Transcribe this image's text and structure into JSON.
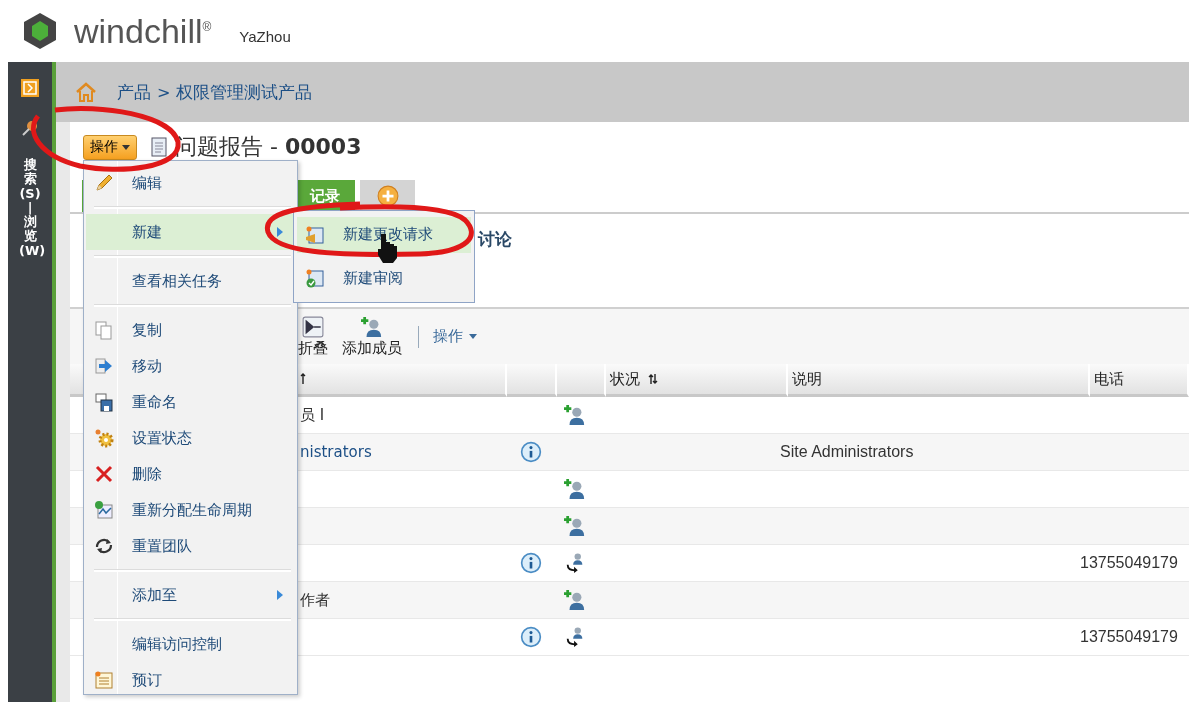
{
  "header": {
    "logo": "windchill$^{®}$",
    "user": "YaZhou"
  },
  "nav": {
    "vertical_label": "搜索(S) | 浏览(W)"
  },
  "breadcrumb": {
    "items": [
      "产品",
      "权限管理测试产品"
    ],
    "separator": ">"
  },
  "title": {
    "actions_button": "操作",
    "text": "问题报告 - **00003**"
  },
  "tabs": [
    {
      "kind": "text",
      "label": "记录",
      "selected": true
    },
    {
      "kind": "icon",
      "selected": false
    }
  ],
  "section_heading": "讨论",
  "toolbar": [
    {
      "kind": "collapse",
      "label": "折叠"
    },
    {
      "kind": "add-member",
      "label": "添加成员"
    },
    {
      "kind": "dropdown",
      "label": "操作"
    }
  ],
  "table": {
    "columns": [
      {
        "kind": "sorted"
      },
      {
        "kind": "plain"
      },
      {
        "kind": "plain"
      },
      {
        "kind": "sortable",
        "label": "状况"
      },
      {
        "kind": "plain",
        "label": "说明"
      },
      {
        "kind": "plain",
        "label": "电话"
      }
    ],
    "rows": [
      {
        "kind": "add-member",
        "name": "员 I"
      },
      {
        "kind": "group",
        "name": "nistrators",
        "description": "Site Administrators"
      },
      {
        "kind": "add-member"
      },
      {
        "kind": "add-member"
      },
      {
        "kind": "user",
        "phone": "13755049179"
      },
      {
        "kind": "add-member",
        "name": "作者"
      },
      {
        "kind": "user",
        "phone": "13755049179"
      }
    ]
  },
  "menu": [
    {
      "kind": "pencil",
      "label": "编辑",
      "selected": false
    },
    {
      "kind": "separator"
    },
    {
      "kind": "submenu",
      "label": "新建",
      "selected": true
    },
    {
      "kind": "separator"
    },
    {
      "kind": "plain",
      "label": "查看相关任务",
      "selected": false
    },
    {
      "kind": "separator"
    },
    {
      "kind": "copy",
      "label": "复制",
      "selected": false
    },
    {
      "kind": "move",
      "label": "移动",
      "selected": false
    },
    {
      "kind": "rename",
      "label": "重命名",
      "selected": false
    },
    {
      "kind": "gear",
      "label": "设置状态",
      "selected": false
    },
    {
      "kind": "delete",
      "label": "删除",
      "selected": false
    },
    {
      "kind": "lifecycle",
      "label": "重新分配生命周期",
      "selected": false
    },
    {
      "kind": "reset",
      "label": "重置团队",
      "selected": false
    },
    {
      "kind": "separator"
    },
    {
      "kind": "submenu",
      "label": "添加至",
      "selected": false
    },
    {
      "kind": "separator"
    },
    {
      "kind": "plain",
      "label": "编辑访问控制",
      "selected": false
    },
    {
      "kind": "notepad",
      "label": "预订",
      "selected": false
    }
  ],
  "submenu": [
    {
      "kind": "change-request",
      "label": "新建更改请求",
      "selected": true
    },
    {
      "kind": "review",
      "label": "新建审阅",
      "selected": false
    }
  ]
}
